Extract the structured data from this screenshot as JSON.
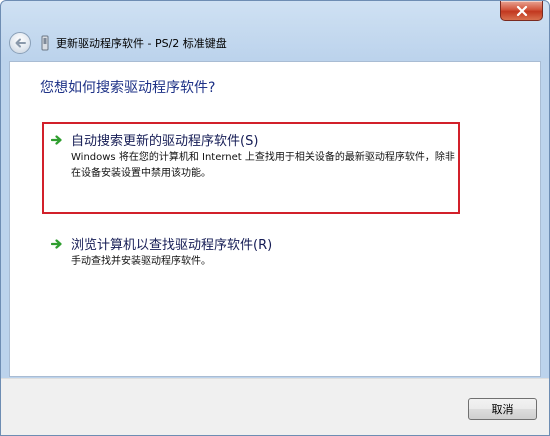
{
  "window": {
    "title": "更新驱动程序软件 - PS/2 标准键盘"
  },
  "main": {
    "question": "您想如何搜索驱动程序软件?",
    "options": [
      {
        "title": "自动搜索更新的驱动程序软件(S)",
        "description": "Windows 将在您的计算机和 Internet 上查找用于相关设备的最新驱动程序软件，除非在设备安装设置中禁用该功能。",
        "selected": true
      },
      {
        "title": "浏览计算机以查找驱动程序软件(R)",
        "description": "手动查找并安装驱动程序软件。",
        "selected": false
      }
    ]
  },
  "footer": {
    "cancel_label": "取消"
  },
  "colors": {
    "highlight_border": "#d2202a",
    "link_text": "#151c55",
    "arrow_green": "#2f9e2f"
  },
  "icons": {
    "close": "close-icon",
    "back": "back-arrow-icon",
    "wizard": "keyboard-driver-icon",
    "option": "green-arrow-icon"
  }
}
